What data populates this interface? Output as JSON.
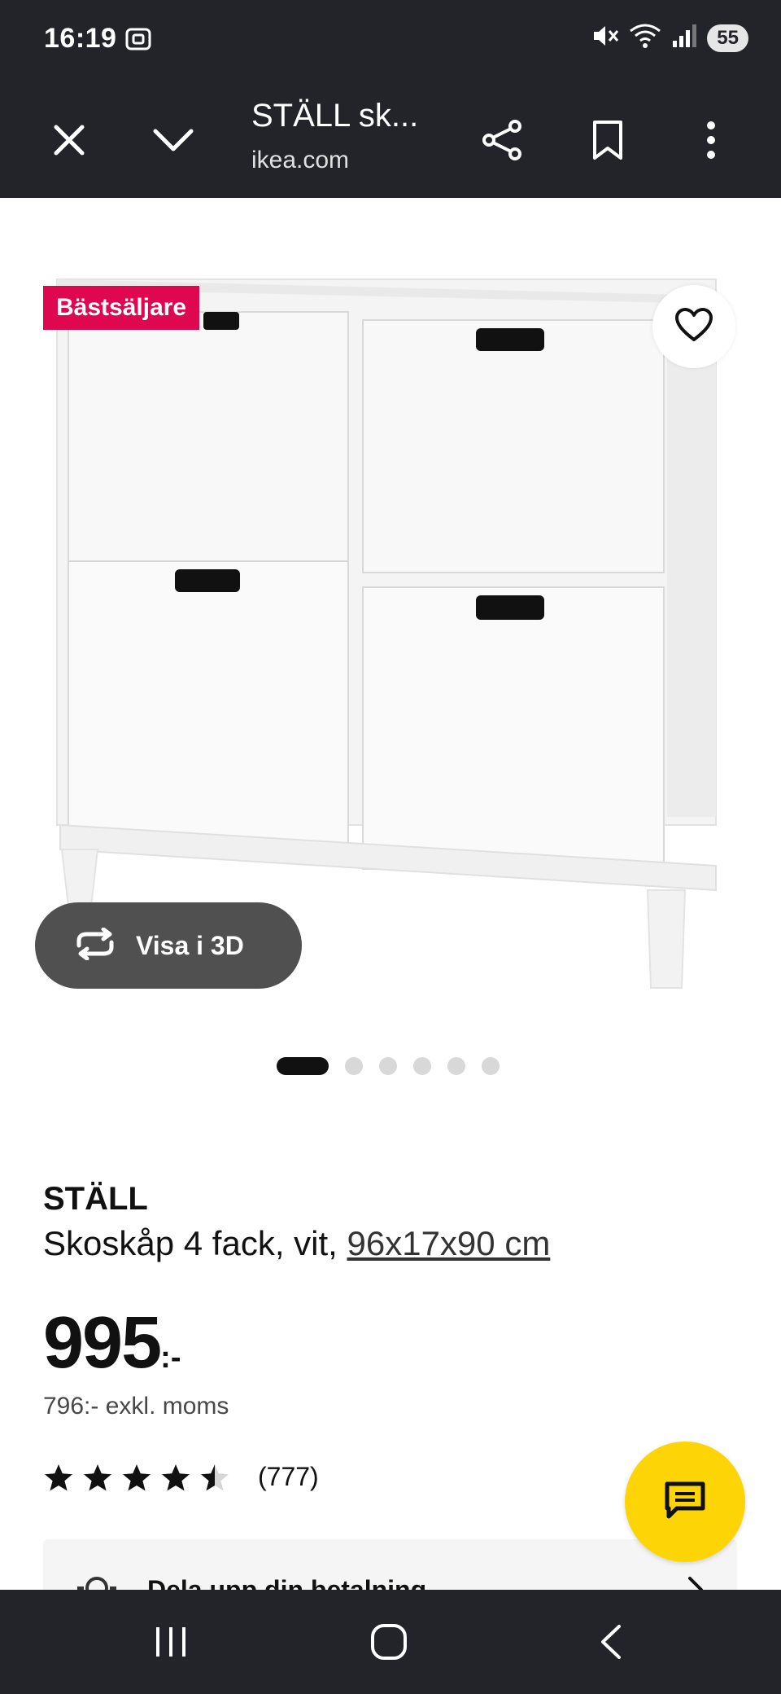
{
  "status_bar": {
    "time": "16:19",
    "battery": "55",
    "icons": [
      "screenshot-icon",
      "mute-icon",
      "wifi-icon",
      "signal-icon",
      "battery-icon"
    ]
  },
  "browser": {
    "title": "STÄLL sk...",
    "domain": "ikea.com",
    "icons": [
      "close-icon",
      "chevron-down-icon",
      "share-icon",
      "bookmark-icon",
      "more-vertical-icon"
    ]
  },
  "product_image": {
    "badge": "Bästsäljare",
    "view_3d_label": "Visa i 3D",
    "carousel": {
      "total": 6,
      "active_index": 0
    }
  },
  "product": {
    "name": "STÄLL",
    "description": "Skoskåp 4 fack, vit, ",
    "dimensions": "96x17x90 cm",
    "price": "995",
    "price_suffix": ":-",
    "price_excl_vat": "796:- exkl. moms",
    "rating": 4.5,
    "rating_max": 5,
    "review_count": "(777)"
  },
  "payment": {
    "label": "Dela upp din betalning"
  },
  "colors": {
    "dark_bar": "#23242a",
    "badge_red": "#e00751",
    "chat_yellow": "#fdd506"
  }
}
